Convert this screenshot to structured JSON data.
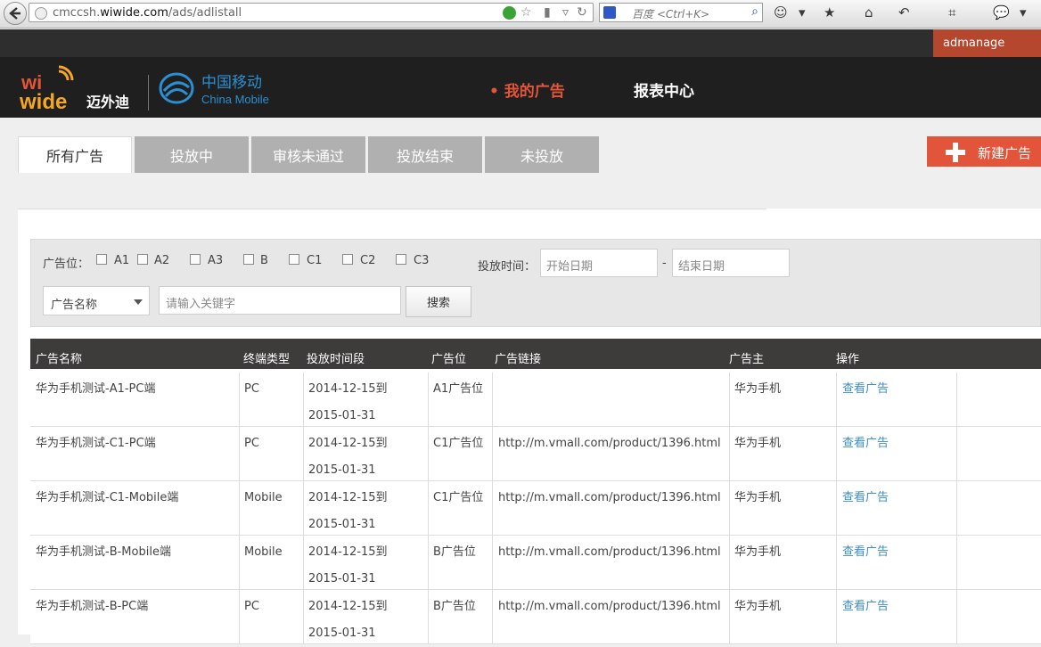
{
  "browser": {
    "url_prefix": "cmccsh.",
    "url_domain": "wiwide.com",
    "url_path": "/ads/adlistall",
    "search_engine_label": "百度",
    "search_placeholder": "百度 <Ctrl+K>"
  },
  "topbar": {
    "user": "admanage"
  },
  "header": {
    "logo_wiwide_text": "wi wide",
    "logo_wiwide_cn": "迈外迪",
    "logo_cm_cn": "中国移动",
    "logo_cm_en": "China Mobile",
    "nav": [
      {
        "label": "我的广告",
        "active": true
      },
      {
        "label": "报表中心",
        "active": false
      }
    ]
  },
  "tabs": [
    {
      "label": "所有广告",
      "active": true
    },
    {
      "label": "投放中",
      "active": false
    },
    {
      "label": "审核未通过",
      "active": false
    },
    {
      "label": "投放结束",
      "active": false
    },
    {
      "label": "未投放",
      "active": false
    }
  ],
  "new_button": {
    "label": "新建广告"
  },
  "filter": {
    "position_label": "广告位：",
    "positions": [
      "A1",
      "A2",
      "A3",
      "B",
      "C1",
      "C2",
      "C3"
    ],
    "time_label": "投放时间：",
    "start_placeholder": "开始日期",
    "date_sep": "-",
    "end_placeholder": "结束日期",
    "field_select": "广告名称",
    "keyword_placeholder": "请输入关键字",
    "search_label": "搜索"
  },
  "table": {
    "headers": [
      "广告名称",
      "终端类型",
      "投放时间段",
      "广告位",
      "广告链接",
      "广告主",
      "操作"
    ],
    "rows": [
      {
        "name": "华为手机测试-A1-PC端",
        "terminal": "PC",
        "start": "2014-12-15到",
        "end": "2015-01-31",
        "position": "A1广告位",
        "link": "",
        "owner": "华为手机",
        "action": "查看广告"
      },
      {
        "name": "华为手机测试-C1-PC端",
        "terminal": "PC",
        "start": "2014-12-15到",
        "end": "2015-01-31",
        "position": "C1广告位",
        "link": "http://m.vmall.com/product/1396.html",
        "owner": "华为手机",
        "action": "查看广告"
      },
      {
        "name": "华为手机测试-C1-Mobile端",
        "terminal": "Mobile",
        "start": "2014-12-15到",
        "end": "2015-01-31",
        "position": "C1广告位",
        "link": "http://m.vmall.com/product/1396.html",
        "owner": "华为手机",
        "action": "查看广告"
      },
      {
        "name": "华为手机测试-B-Mobile端",
        "terminal": "Mobile",
        "start": "2014-12-15到",
        "end": "2015-01-31",
        "position": "B广告位",
        "link": "http://m.vmall.com/product/1396.html",
        "owner": "华为手机",
        "action": "查看广告"
      },
      {
        "name": "华为手机测试-B-PC端",
        "terminal": "PC",
        "start": "2014-12-15到",
        "end": "2015-01-31",
        "position": "B广告位",
        "link": "http://m.vmall.com/product/1396.html",
        "owner": "华为手机",
        "action": "查看广告"
      }
    ]
  },
  "colors": {
    "accent": "#e2553a",
    "header_bg": "#1f1f1f",
    "table_head": "#3e3b3b",
    "link": "#3d8ec3",
    "tab_inactive": "#b0b0b0"
  }
}
